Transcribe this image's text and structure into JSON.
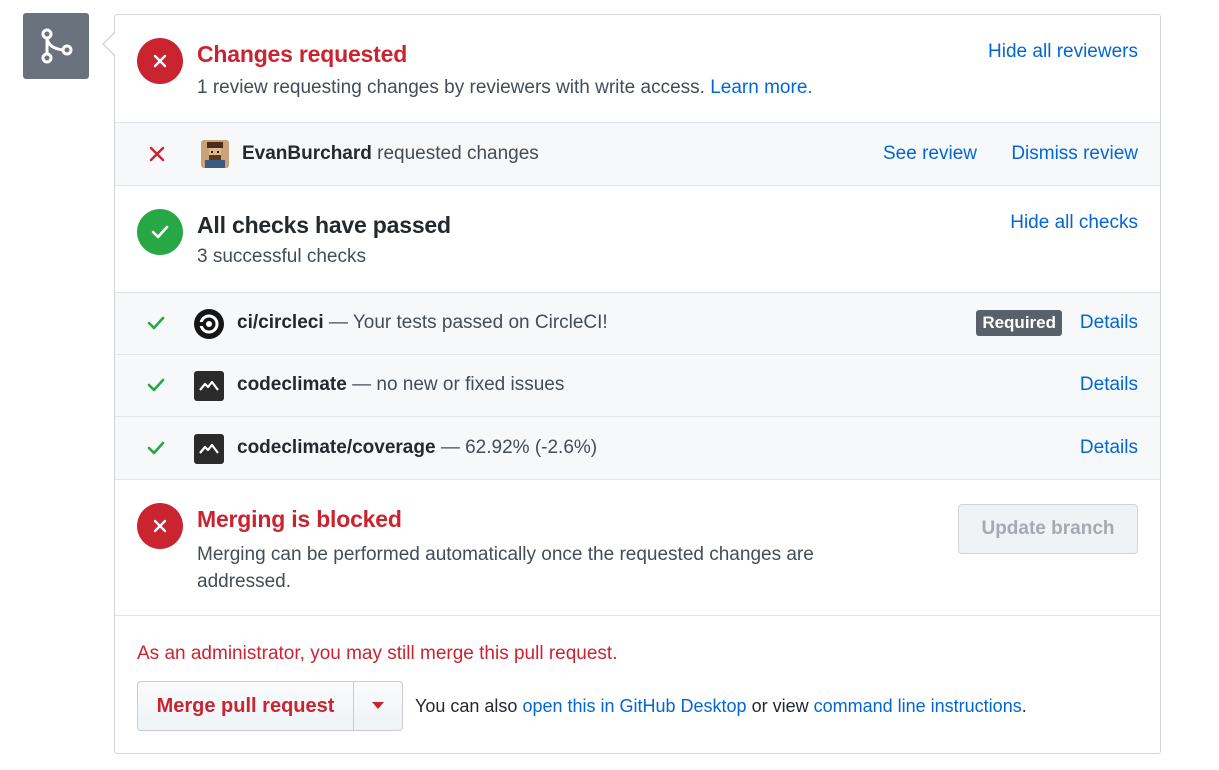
{
  "reviews": {
    "title": "Changes requested",
    "subtitle": "1 review requesting changes by reviewers with write access.",
    "learn_more": "Learn more.",
    "toggle": "Hide all reviewers",
    "items": [
      {
        "user": "EvanBurchard",
        "action": "requested changes",
        "see_review": "See review",
        "dismiss": "Dismiss review"
      }
    ]
  },
  "checks": {
    "title": "All checks have passed",
    "subtitle": "3 successful checks",
    "toggle": "Hide all checks",
    "items": [
      {
        "name": "ci/circleci",
        "description": "— Your tests passed on CircleCI!",
        "badge": "Required",
        "details": "Details",
        "icon": "circleci-icon"
      },
      {
        "name": "codeclimate",
        "description": "— no new or fixed issues",
        "details": "Details",
        "icon": "codeclimate-icon"
      },
      {
        "name": "codeclimate/coverage",
        "description": "— 62.92% (-2.6%)",
        "details": "Details",
        "icon": "codeclimate-icon"
      }
    ]
  },
  "merge": {
    "title": "Merging is blocked",
    "description": "Merging can be performed automatically once the requested changes are addressed.",
    "update_branch": "Update branch",
    "admin_note": "As an administrator, you may still merge this pull request.",
    "merge_button": "Merge pull request",
    "also_prefix": "You can also",
    "open_desktop": "open this in GitHub Desktop",
    "or_view": "or view",
    "cli": "command line instructions",
    "period": "."
  },
  "colors": {
    "error": "#cb2431",
    "success": "#28a745",
    "link": "#0366d6",
    "icon_bg": "#6a737d"
  }
}
